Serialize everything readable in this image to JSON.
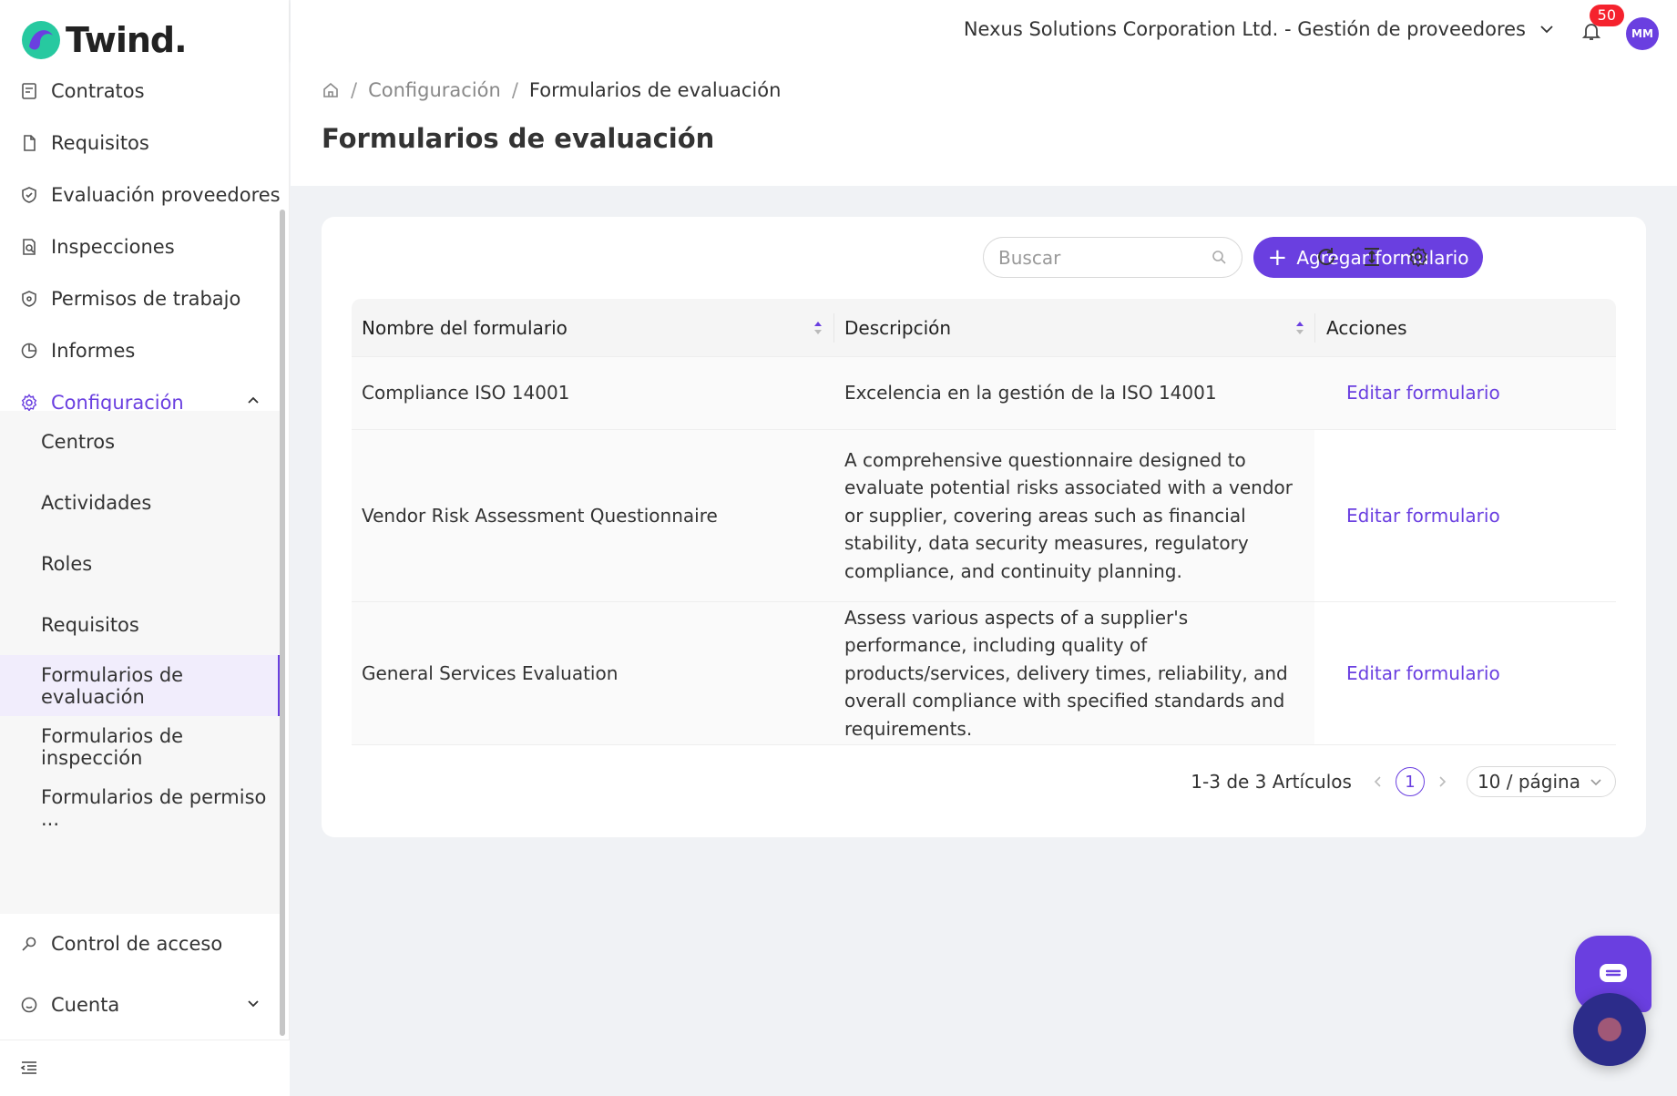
{
  "app": {
    "brand": "Twind."
  },
  "header": {
    "organization": "Nexus Solutions Corporation Ltd. - Gestión de proveedores",
    "notifications_count": "50",
    "user_initials": "MM"
  },
  "sidebar": {
    "items": [
      {
        "label": "Contratos",
        "icon": "contract-icon"
      },
      {
        "label": "Requisitos",
        "icon": "file-icon"
      },
      {
        "label": "Evaluación proveedores",
        "icon": "shield-check-icon"
      },
      {
        "label": "Inspecciones",
        "icon": "file-search-icon"
      },
      {
        "label": "Permisos de trabajo",
        "icon": "shield-icon"
      },
      {
        "label": "Informes",
        "icon": "pie-chart-icon"
      },
      {
        "label": "Configuración",
        "icon": "gear-icon"
      },
      {
        "label": "Control de acceso",
        "icon": "key-icon"
      },
      {
        "label": "Cuenta",
        "icon": "smile-icon"
      }
    ],
    "config_submenu": [
      {
        "label": "Centros"
      },
      {
        "label": "Actividades"
      },
      {
        "label": "Roles"
      },
      {
        "label": "Requisitos"
      },
      {
        "label": "Formularios de evaluación"
      },
      {
        "label": "Formularios de inspección"
      },
      {
        "label": "Formularios de permiso ..."
      }
    ]
  },
  "breadcrumb": {
    "items": [
      "Configuración",
      "Formularios de evaluación"
    ]
  },
  "page": {
    "title": "Formularios de evaluación"
  },
  "toolbar": {
    "search_placeholder": "Buscar",
    "add_label": "Agregar formulario"
  },
  "table": {
    "columns": [
      "Nombre del formulario",
      "Descripción",
      "Acciones"
    ],
    "rows": [
      {
        "name": "Compliance ISO 14001",
        "description": "Excelencia en la gestión de la ISO 14001",
        "action": "Editar formulario"
      },
      {
        "name": "Vendor Risk Assessment Questionnaire",
        "description": "A comprehensive questionnaire designed to evaluate potential risks associated with a vendor or supplier, covering areas such as financial stability, data security measures, regulatory compliance, and continuity planning.",
        "action": "Editar formulario"
      },
      {
        "name": "General Services Evaluation",
        "description": "Assess various aspects of a supplier's performance, including quality of products/services, delivery times, reliability, and overall compliance with specified standards and requirements.",
        "action": "Editar formulario"
      }
    ]
  },
  "pagination": {
    "summary": "1-3 de 3 Artículos",
    "current_page": "1",
    "page_size": "10 / página"
  },
  "colors": {
    "accent": "#6a3fe0",
    "badge": "#f5222d"
  }
}
